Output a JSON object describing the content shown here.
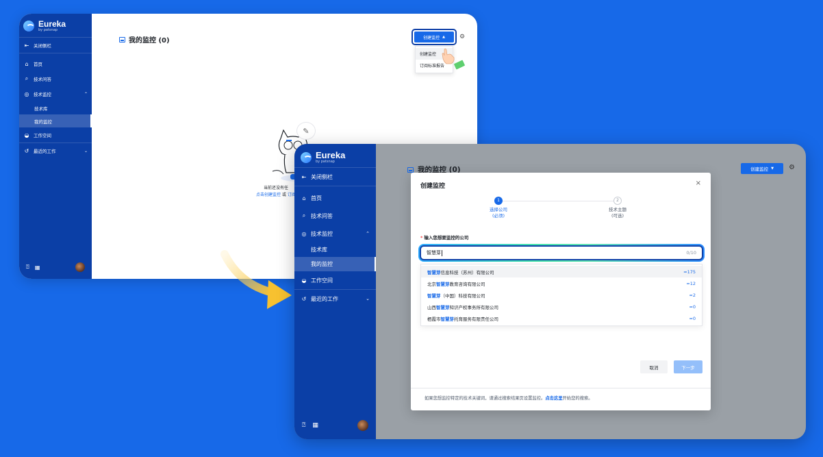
{
  "colors": {
    "background": "#1769e8",
    "sidebar": "#0b3fa6",
    "accent": "#1769e8"
  },
  "brand": {
    "name": "Eureka",
    "sub": "by patsnap"
  },
  "sidebar": {
    "collapse": "关闭侧栏",
    "home": "首页",
    "qa": "技术问答",
    "monitor": "技术监控",
    "monitor_subs": [
      "技术库",
      "我的监控"
    ],
    "workspace": "工作空间",
    "recent": "最近的工作"
  },
  "window1": {
    "title": "我的监控 (0)",
    "create_button": "创建监控",
    "menu": [
      "创建监控",
      "订阅标准报告"
    ],
    "empty_text": "当前还没有任",
    "empty_link1": "点击创建监控",
    "empty_or": "或",
    "empty_link2": "订阅"
  },
  "window2": {
    "title": "我的监控 (0)",
    "create_button": "创建监控",
    "modal": {
      "title": "创建监控",
      "close": "×",
      "steps": [
        {
          "num": "1",
          "label": "选择公司",
          "note": "(必须)"
        },
        {
          "num": "2",
          "label": "技术主题",
          "note": "(可选)"
        }
      ],
      "field_label": "输入您想要监控的公司",
      "input_value": "智慧芽",
      "input_count": "0/10",
      "suggestions": [
        {
          "pre": "",
          "hl": "智慧芽",
          "post": "信息科技（苏州）有限公司",
          "count": "≈175"
        },
        {
          "pre": "北京",
          "hl": "智慧芽",
          "post": "教育咨询有限公司",
          "count": "≈12"
        },
        {
          "pre": "",
          "hl": "智慧芽",
          "post": "（中国）科技有限公司",
          "count": "≈2"
        },
        {
          "pre": "山西",
          "hl": "智慧芽",
          "post": "知识产权事务所有限公司",
          "count": "≈0"
        },
        {
          "pre": "栖霞市",
          "hl": "智慧芽",
          "post": "托育服务有限责任公司",
          "count": "≈0"
        }
      ],
      "cancel": "取消",
      "next": "下一步",
      "footer_pre": "如果您想监控特定的技术关键词，请通过搜索结果页设置监控。",
      "footer_link": "点击这里",
      "footer_post": "开始您的搜索。"
    }
  }
}
